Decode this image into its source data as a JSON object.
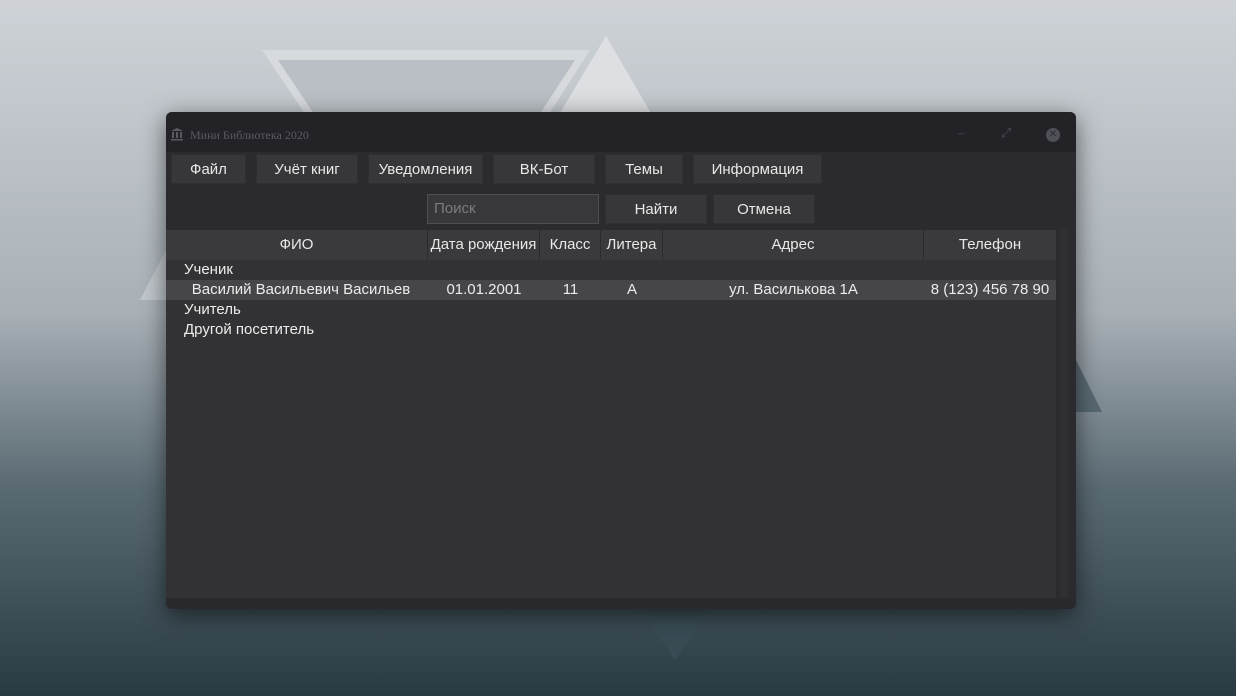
{
  "window": {
    "title": "Мини Библиотека 2020"
  },
  "menu": {
    "items": [
      {
        "label": "Файл"
      },
      {
        "label": "Учёт книг"
      },
      {
        "label": "Уведомления"
      },
      {
        "label": "ВК-Бот"
      },
      {
        "label": "Темы"
      },
      {
        "label": "Информация"
      }
    ]
  },
  "search": {
    "placeholder": "Поиск",
    "find_label": "Найти",
    "cancel_label": "Отмена"
  },
  "table": {
    "columns": [
      "ФИО",
      "Дата рождения",
      "Класс",
      "Литера",
      "Адрес",
      "Телефон"
    ],
    "groups": [
      {
        "name": "Ученик",
        "rows": [
          {
            "fio": "Василий Васильевич Васильев",
            "birth": "01.01.2001",
            "class": "11",
            "letter": "А",
            "address": "ул. Василькова 1А",
            "phone": "8 (123) 456 78 90"
          }
        ]
      },
      {
        "name": "Учитель",
        "rows": []
      },
      {
        "name": "Другой посетитель",
        "rows": []
      }
    ]
  },
  "colors": {
    "window_bg": "#2b2b2f",
    "titlebar_bg": "#222227",
    "button_bg": "#373739",
    "selected_row": "#464649"
  }
}
